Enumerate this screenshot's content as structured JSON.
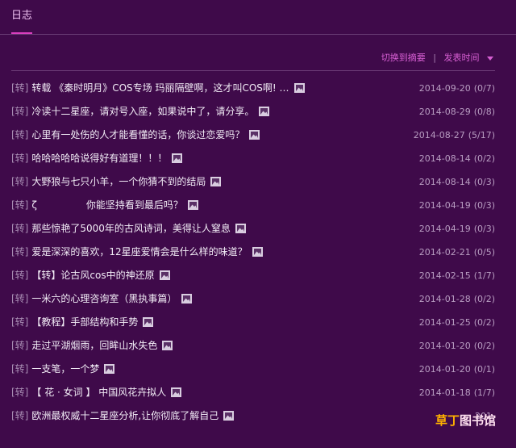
{
  "tab": {
    "label": "日志"
  },
  "sort": {
    "summary_label": "切换到摘要",
    "separator": "|",
    "time_label": "发表时间"
  },
  "items": [
    {
      "prefix": "[转]",
      "title": "转载 《秦时明月》COS专场 玛丽隔壁啊，这才叫COS啊! …",
      "date": "2014-09-20",
      "counts": "(0/7)"
    },
    {
      "prefix": "[转]",
      "title": "冷读十二星座，请对号入座，如果说中了，请分享。",
      "date": "2014-08-29",
      "counts": "(0/8)"
    },
    {
      "prefix": "[转]",
      "title": "心里有一处伤的人才能看懂的话，你谈过恋爱吗？",
      "date": "2014-08-27",
      "counts": "(5/17)"
    },
    {
      "prefix": "[转]",
      "title": "哈哈哈哈哈说得好有道理！！！",
      "date": "2014-08-14",
      "counts": "(0/2)"
    },
    {
      "prefix": "[转]",
      "title": "大野狼与七只小羊，一个你猜不到的结局",
      "date": "2014-08-14",
      "counts": "(0/3)"
    },
    {
      "prefix": "[转]",
      "title": "ζ                你能坚持看到最后吗？",
      "date": "2014-04-19",
      "counts": "(0/3)"
    },
    {
      "prefix": "[转]",
      "title": "那些惊艳了5000年的古风诗词，美得让人窒息",
      "date": "2014-04-19",
      "counts": "(0/3)"
    },
    {
      "prefix": "[转]",
      "title": "爱是深深的喜欢，12星座爱情会是什么样的味道？",
      "date": "2014-02-21",
      "counts": "(0/5)"
    },
    {
      "prefix": "[转]",
      "title": "【转】论古风cos中的神还原",
      "date": "2014-02-15",
      "counts": "(1/7)"
    },
    {
      "prefix": "[转]",
      "title": "一米六的心理咨询室（黑执事篇）",
      "date": "2014-01-28",
      "counts": "(0/2)"
    },
    {
      "prefix": "[转]",
      "title": "【教程】手部结构和手势",
      "date": "2014-01-25",
      "counts": "(0/2)"
    },
    {
      "prefix": "[转]",
      "title": "走过平湖烟雨，回眸山水失色",
      "date": "2014-01-20",
      "counts": "(0/2)"
    },
    {
      "prefix": "[转]",
      "title": "一支笔，一个梦",
      "date": "2014-01-20",
      "counts": "(0/1)"
    },
    {
      "prefix": "[转]",
      "title": "【 花 · 女词 】 中国风花卉拟人",
      "date": "2014-01-18",
      "counts": "(1/7)"
    },
    {
      "prefix": "[转]",
      "title": "欧洲最权威十二星座分析,让你彻底了解自己",
      "date": "201",
      "counts": ""
    }
  ],
  "watermark": {
    "part1": "草丁",
    "part2": "图书馆"
  },
  "colors": {
    "background": "#3f0a4a",
    "accent": "#d83fbe",
    "link": "#d75fd3"
  }
}
